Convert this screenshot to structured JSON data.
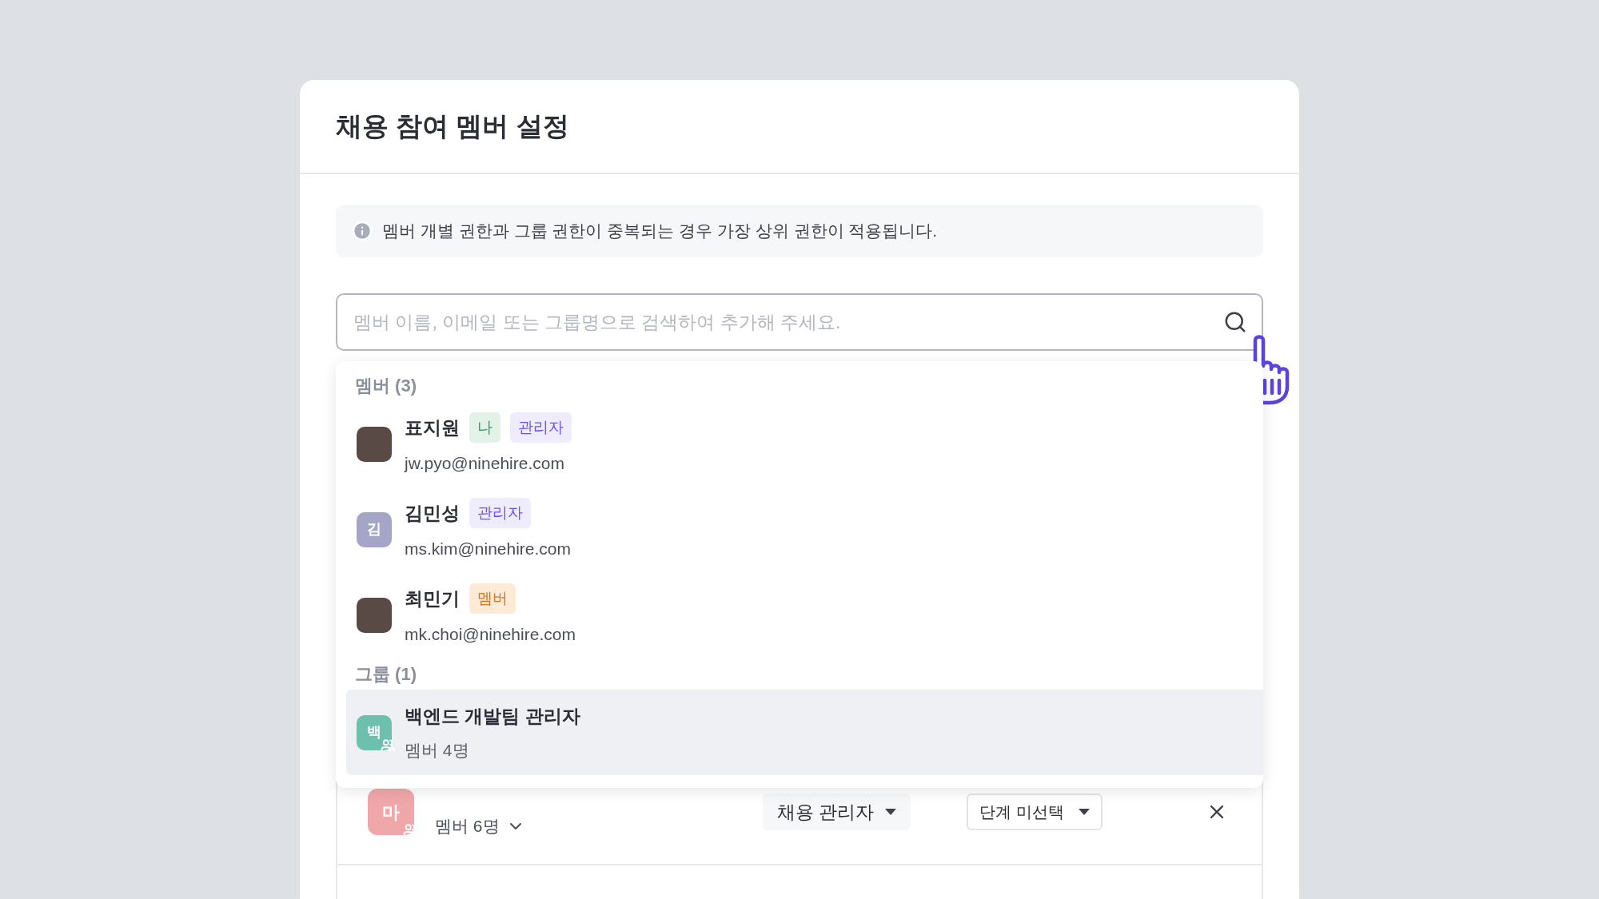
{
  "dialog": {
    "title": "채용 참여 멤버 설정"
  },
  "notice": {
    "text": "멤버 개별 권한과 그룹 권한이 중복되는 경우 가장 상위 권한이 적용됩니다."
  },
  "search": {
    "placeholder": "멤버 이름, 이메일 또는 그룹명으로 검색하여 추가해 주세요."
  },
  "results": {
    "sections": [
      {
        "heading": "멤버 (3)",
        "items": [
          {
            "name": "표지원",
            "subtitle": "jw.pyo@ninehire.com",
            "avatar": {
              "kind": "photo"
            },
            "badges": [
              {
                "label": "나",
                "kind": "me"
              },
              {
                "label": "관리자",
                "kind": "admin"
              }
            ],
            "selected": false
          },
          {
            "name": "김민성",
            "subtitle": "ms.kim@ninehire.com",
            "avatar": {
              "kind": "initial",
              "initial": "김",
              "color": "#a5a6c7"
            },
            "badges": [
              {
                "label": "관리자",
                "kind": "admin"
              }
            ],
            "selected": false
          },
          {
            "name": "최민기",
            "subtitle": "mk.choi@ninehire.com",
            "avatar": {
              "kind": "photo"
            },
            "badges": [
              {
                "label": "멤버",
                "kind": "member"
              }
            ],
            "selected": false
          }
        ]
      },
      {
        "heading": "그룹 (1)",
        "items": [
          {
            "name": "백엔드 개발팀 관리자",
            "subtitle": "멤버 4명",
            "avatar": {
              "kind": "group",
              "initial": "백",
              "color": "#6dbfae"
            },
            "selected": true
          }
        ]
      }
    ]
  },
  "added_rows": [
    {
      "avatar": {
        "kind": "group",
        "initial": "마",
        "color": "#f0a7aa"
      },
      "member_count": "멤버 6명",
      "role": "채용 관리자",
      "stage": "단계 미선택"
    }
  ]
}
